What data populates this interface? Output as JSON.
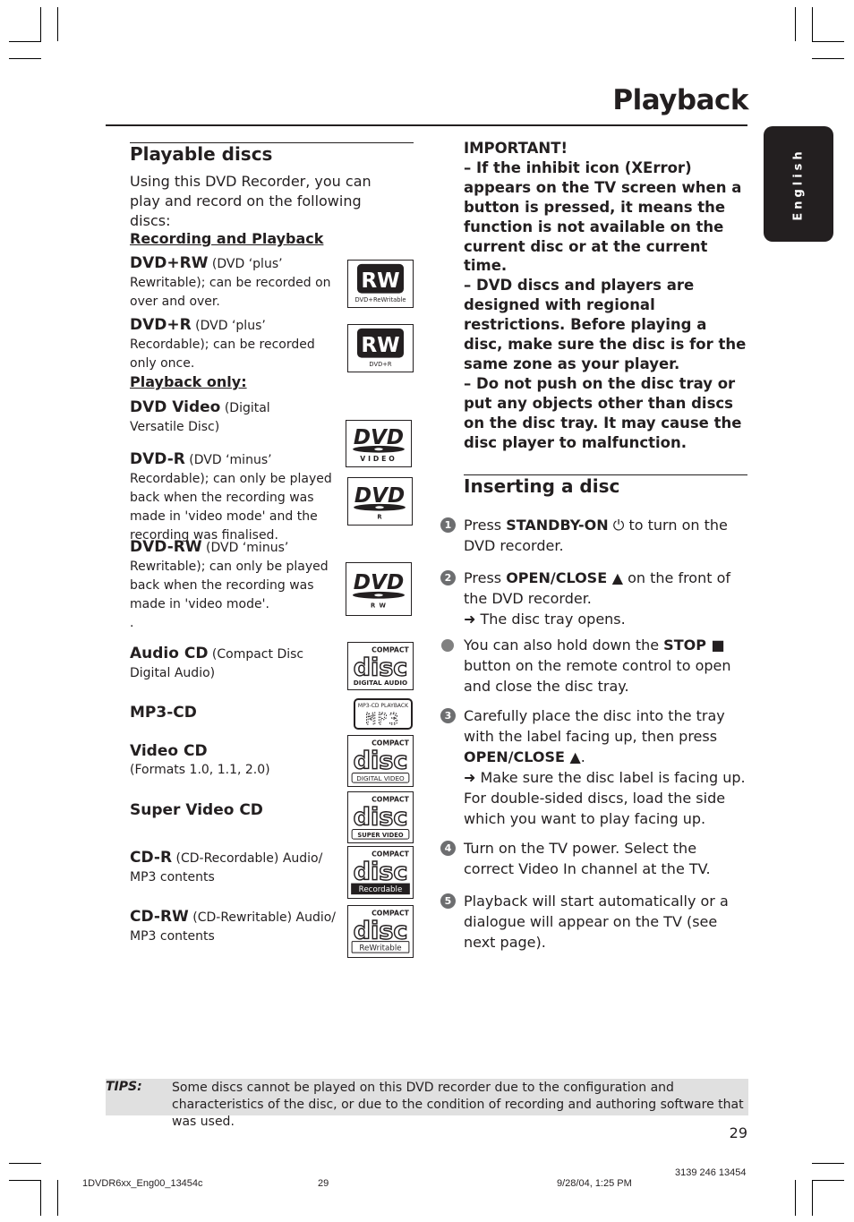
{
  "header": {
    "title": "Playback",
    "language_tab": "English"
  },
  "left": {
    "heading": "Playable discs",
    "intro": "Using this DVD Recorder, you can play and record on the following discs:",
    "recording_section": {
      "title": "Recording and Playback",
      "items": [
        {
          "name": "DVD+RW",
          "desc": " (DVD ‘plus’ Rewritable); can be recorded on over and over.",
          "logo_label": "DVD+ReWritable",
          "logo_mark": "RW"
        },
        {
          "name": "DVD+R",
          "desc": " (DVD ‘plus’ Recordable); can be recorded only once.",
          "logo_label": "DVD+R",
          "logo_mark": "RW"
        }
      ]
    },
    "playback_section": {
      "title": "Playback only:",
      "items": [
        {
          "name": "DVD Video",
          "desc": " (Digital Versatile Disc)",
          "logo_label": "VIDEO"
        },
        {
          "name": "DVD-R",
          "desc": " (DVD ‘minus’ Recordable); can only be played back when the recording was made in 'video mode' and the recording was finalised.",
          "logo_label": "R"
        },
        {
          "name": "DVD-RW",
          "desc": " (DVD ‘minus’ Rewritable); can only be played back when the recording was made in 'video mode'.",
          "trailing": ".",
          "logo_label": "R W"
        },
        {
          "name": "Audio CD",
          "desc": " (Compact Disc Digital Audio)",
          "logo_label": "DIGITAL AUDIO"
        },
        {
          "name": "MP3-CD",
          "desc": "",
          "logo_label": "MP3-CD PLAYBACK",
          "logo_mark": "MP3"
        },
        {
          "name": "Video CD",
          "desc": "(Formats 1.0, 1.1, 2.0)",
          "logo_label": "DIGITAL VIDEO"
        },
        {
          "name": "Super Video CD",
          "desc": "",
          "logo_label": "SUPER VIDEO"
        },
        {
          "name": "CD-R",
          "desc": " (CD-Recordable) Audio/ MP3 contents",
          "logo_label": "Recordable"
        },
        {
          "name": "CD-RW",
          "desc": " (CD-Rewritable) Audio/ MP3 contents",
          "logo_label": "ReWritable"
        }
      ],
      "logo_common": {
        "compact": "COMPACT",
        "disc": "disc",
        "dvd": "DVD"
      }
    }
  },
  "right": {
    "important": {
      "title": "IMPORTANT!",
      "points": [
        "–  If the inhibit icon (XError) appears on the TV screen when a button is pressed, it means the function is not available on the current disc or at the current time.",
        "–  DVD discs and players are designed with regional restrictions. Before playing a disc, make sure the disc is for the same zone as your player.",
        "–  Do not push on the disc tray or put any objects other than discs on the disc tray.  It may cause the disc player to malfunction."
      ]
    },
    "inserting": {
      "heading": "Inserting a disc",
      "steps": [
        {
          "marker": "1",
          "pre": "Press ",
          "bold": "STANDBY-ON",
          "icon": "⏻",
          "post": " to turn on the DVD recorder."
        },
        {
          "marker": "2",
          "pre": "Press ",
          "bold": "OPEN/CLOSE ▲",
          "post": " on the front of the DVD recorder.",
          "result": "➜ The disc tray opens."
        },
        {
          "marker": "bullet",
          "pre": "You can also hold down the ",
          "bold": "STOP ■",
          "post": " button on the remote control to open and close the disc tray."
        },
        {
          "marker": "3",
          "pre": "Carefully place the disc into the tray with the label facing up, then press ",
          "bold": "OPEN/CLOSE ▲",
          "post": ".",
          "result": "➜ Make sure the disc label is facing up. For double-sided discs, load the side which you want to play facing up."
        },
        {
          "marker": "4",
          "pre": "Turn on the TV power.  Select the correct Video In channel at the TV.",
          "bold": "",
          "post": ""
        },
        {
          "marker": "5",
          "pre": "Playback will start automatically or a dialogue will appear on the TV (see next page).",
          "bold": "",
          "post": ""
        }
      ]
    }
  },
  "tips": {
    "label": "TIPS:",
    "text": "Some discs cannot be played on this DVD recorder due to the configuration and characteristics of the disc, or due to the condition of recording and authoring software that was used."
  },
  "page_number": "29",
  "footer": {
    "file": "1DVDR6xx_Eng00_13454c",
    "page": "29",
    "date": "9/28/04, 1:25 PM",
    "code": "3139 246 13454"
  }
}
